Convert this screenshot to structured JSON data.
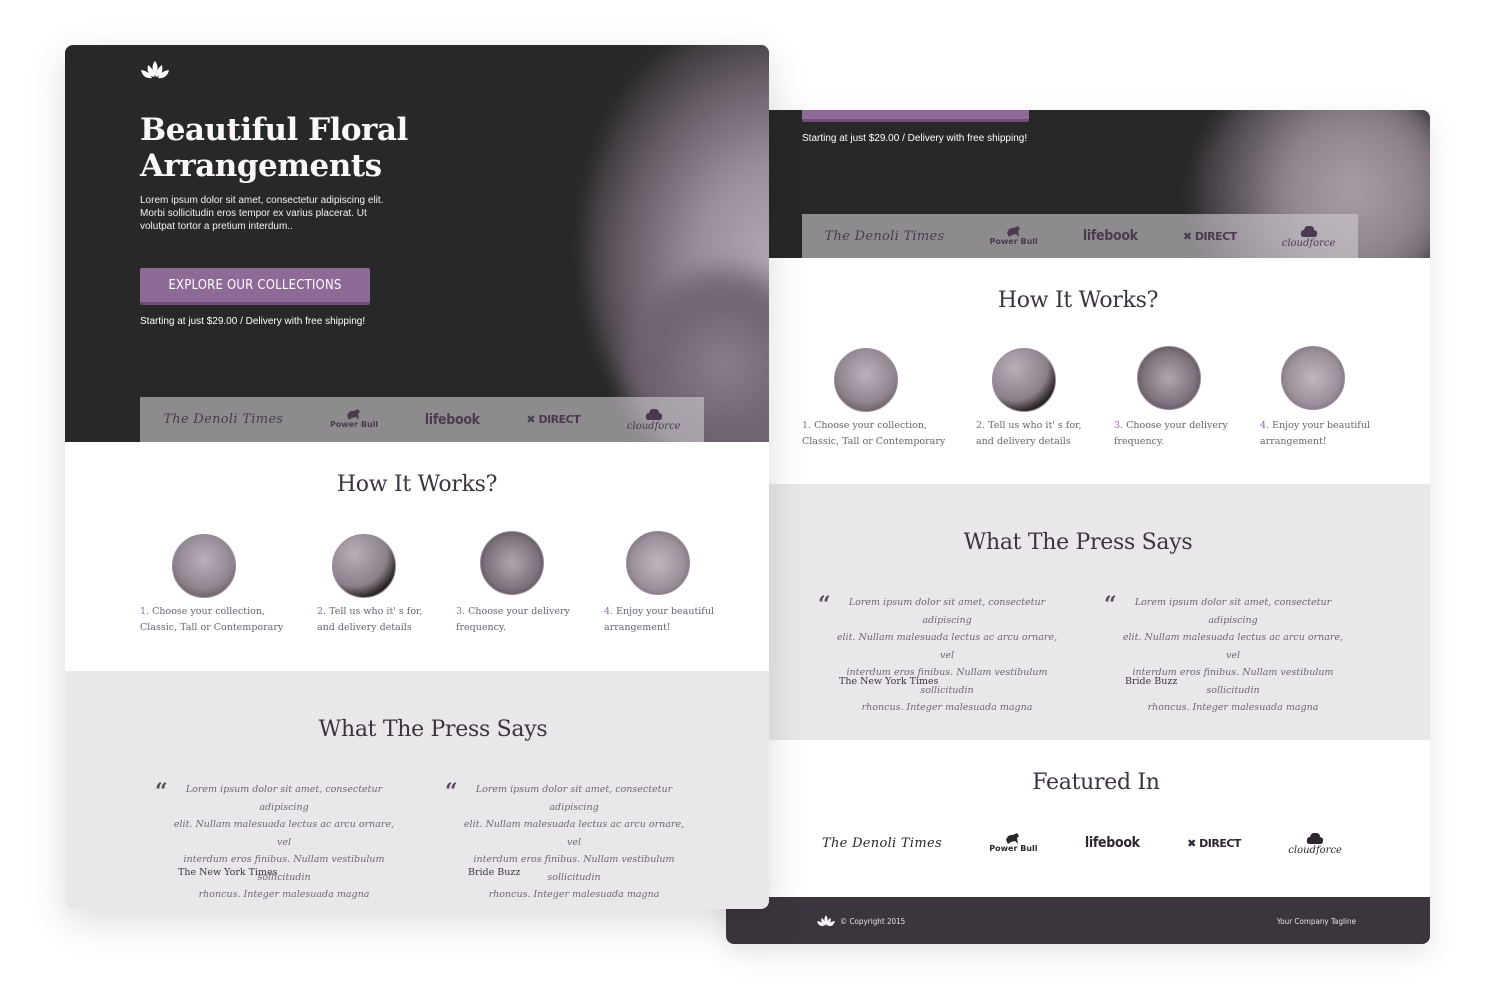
{
  "hero": {
    "logo_icon": "lotus-icon",
    "title_line1": "Beautiful Floral",
    "title_line2": "Arrangements",
    "body_line1": "Lorem ipsum dolor sit amet, consectetur adipiscing elit.",
    "body_line2": "Morbi sollicitudin eros tempor ex varius placerat. Ut",
    "body_line3": "volutpat tortor a pretium interdum..",
    "cta_label": "EXPLORE OUR COLLECTIONS",
    "note": "Starting at just $29.00 / Delivery with free shipping!"
  },
  "brands": [
    {
      "name": "The Denoli Times",
      "line1": "The Denoli Times"
    },
    {
      "name": "Power Bull",
      "line1": "Power",
      "line2": "Bull",
      "icon": "bull-icon"
    },
    {
      "name": "lifebook",
      "line1": "lifebook"
    },
    {
      "name": "DIRECT",
      "line1": "DIRECT",
      "icon": "x-icon"
    },
    {
      "name": "cloudforce",
      "line1": "cloud",
      "line2": "force",
      "icon": "cloud-icon"
    }
  ],
  "how_it_works": {
    "title": "How It Works?",
    "steps": [
      {
        "num": "1.",
        "line1": " Choose your collection,",
        "line2": "Classic, Tall or Contemporary"
      },
      {
        "num": "2.",
        "line1": " Tell us who it' s for,",
        "line2": "and delivery details"
      },
      {
        "num": "3.",
        "line1": " Choose your delivery",
        "line2": "frequency."
      },
      {
        "num": "4.",
        "line1": " Enjoy your beautiful",
        "line2": "arrangement!"
      }
    ]
  },
  "press": {
    "title": "What The Press Says",
    "quote_mark": "“",
    "quotes": [
      {
        "l1": "Lorem ipsum dolor sit amet, consectetur adipiscing",
        "l2": "elit. Nullam malesuada lectus ac arcu ornare, vel",
        "l3": "interdum eros finibus. Nullam vestibulum sollicitudin",
        "l4": "rhoncus. Integer malesuada magna",
        "source": "The New York Times"
      },
      {
        "l1": "Lorem ipsum dolor sit amet, consectetur adipiscing",
        "l2": "elit. Nullam malesuada lectus ac arcu ornare, vel",
        "l3": "interdum eros finibus. Nullam vestibulum sollicitudin",
        "l4": "rhoncus. Integer malesuada magna",
        "source": "Bride Buzz"
      }
    ]
  },
  "featured": {
    "title": "Featured In"
  },
  "footer": {
    "copyright": "© Copyright 2015",
    "tagline": "Your Company Tagline"
  },
  "colors": {
    "accent": "#8e6a97",
    "hero_bg": "#282828",
    "heading": "#3d3340",
    "grey_section": "#e9e7ea",
    "footer_bg": "#3d353e"
  }
}
